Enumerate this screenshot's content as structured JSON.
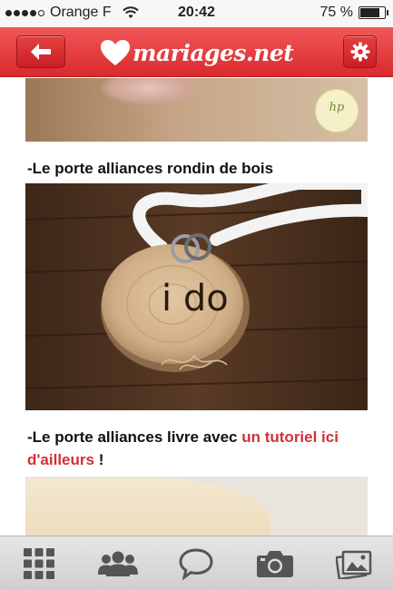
{
  "status_bar": {
    "carrier": "Orange F",
    "time": "20:42",
    "battery_percent": "75 %",
    "battery_level": 0.75
  },
  "nav": {
    "logo_text": "mariages.net",
    "back_icon": "arrow-left-icon",
    "settings_icon": "gear-icon"
  },
  "article": {
    "captions": [
      {
        "text": "-Le porte alliances rondin de bois"
      },
      {
        "text": "-Le porte alliances livre avec ",
        "link": "un tutoriel ici d'ailleurs",
        "suffix": " !"
      }
    ],
    "image_texts": {
      "ring_holder": "i do",
      "badge": "hp"
    }
  },
  "tab_bar": {
    "tabs": [
      {
        "icon": "grid-icon"
      },
      {
        "icon": "community-icon"
      },
      {
        "icon": "chat-bubble-icon"
      },
      {
        "icon": "camera-icon"
      },
      {
        "icon": "photos-icon"
      }
    ]
  },
  "colors": {
    "brand_red": "#e03a3e",
    "link_red": "#d03139"
  }
}
